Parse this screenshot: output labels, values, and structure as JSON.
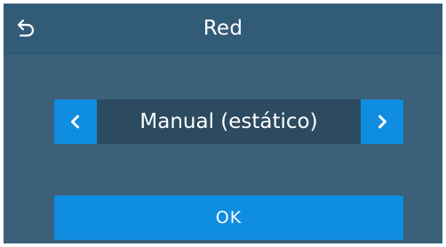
{
  "header": {
    "title": "Red",
    "back_icon": "back-arrow-icon"
  },
  "selector": {
    "value": "Manual (estático)",
    "prev_icon": "chevron-left-icon",
    "next_icon": "chevron-right-icon"
  },
  "actions": {
    "ok_label": "OK"
  },
  "colors": {
    "background": "#3b6079",
    "header": "#325b78",
    "selector_field": "#2c4b61",
    "accent": "#0f8de0",
    "text": "#ffffff"
  }
}
